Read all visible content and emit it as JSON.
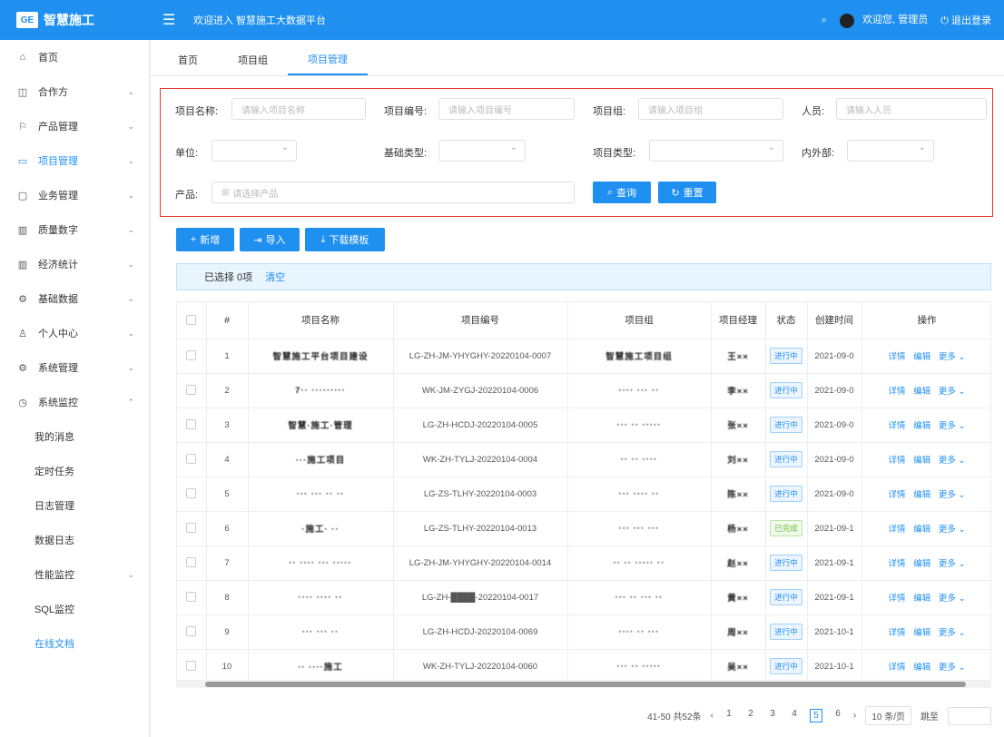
{
  "header": {
    "logo_badge": "GE",
    "app_name": "智慧施工",
    "welcome_text": "欢迎进入 智慧施工大数据平台",
    "user_greeting": "欢迎您,",
    "user_name": "管理员",
    "logout_label": "退出登录",
    "search_icon": "search-icon",
    "menu_icon": "menu-fold-icon"
  },
  "sidebar": {
    "items": [
      {
        "label": "首页",
        "icon": "⌂",
        "arrow": ""
      },
      {
        "label": "合作方",
        "icon": "◫",
        "arrow": "⌄"
      },
      {
        "label": "产品管理",
        "icon": "⚐",
        "arrow": "⌄"
      },
      {
        "label": "项目管理",
        "icon": "▭",
        "arrow": "⌄"
      },
      {
        "label": "业务管理",
        "icon": "▢",
        "arrow": "⌄"
      },
      {
        "label": "质量数字",
        "icon": "▥",
        "arrow": "⌄"
      },
      {
        "label": "经济统计",
        "icon": "▥",
        "arrow": "⌄"
      },
      {
        "label": "基础数据",
        "icon": "⚙",
        "arrow": "⌄"
      },
      {
        "label": "个人中心",
        "icon": "♙",
        "arrow": "⌄"
      },
      {
        "label": "系统管理",
        "icon": "⚙",
        "arrow": "⌄"
      },
      {
        "label": "系统监控",
        "icon": "◷",
        "arrow": "⌃"
      }
    ],
    "sub_items": [
      {
        "label": "我的消息",
        "arrow": ""
      },
      {
        "label": "定时任务",
        "arrow": ""
      },
      {
        "label": "日志管理",
        "arrow": ""
      },
      {
        "label": "数据日志",
        "arrow": ""
      },
      {
        "label": "性能监控",
        "arrow": "⌄"
      },
      {
        "label": "SQL监控",
        "arrow": ""
      },
      {
        "label": "在线文档",
        "arrow": ""
      }
    ]
  },
  "tabs": [
    "首页",
    "项目组",
    "项目管理"
  ],
  "search": {
    "project_name_label": "项目名称:",
    "project_name_ph": "请输入项目名称",
    "project_no_label": "项目编号:",
    "project_no_ph": "请输入项目编号",
    "project_group_label": "项目组:",
    "project_group_ph": "请输入项目组",
    "person_label": "人员:",
    "person_ph": "请输入人员",
    "unit_label": "单位:",
    "base_type_label": "基础类型:",
    "project_type_label": "项目类型:",
    "inner_outer_label": "内外部:",
    "product_label": "产品:",
    "product_ph": "请选择产品",
    "query_label": "查询",
    "reset_label": "重置"
  },
  "actions": {
    "add_label": "新增",
    "import_label": "导入",
    "download_label": "下载模板"
  },
  "selection": {
    "selected_text": "已选择 0项",
    "clear_label": "清空"
  },
  "table": {
    "headers": [
      "",
      "#",
      "项目名称",
      "项目编号",
      "项目组",
      "项目经理",
      "状态",
      "创建时间",
      "操作"
    ],
    "rows": [
      {
        "idx": "1",
        "name": "智慧施工平台项目建设",
        "code": "LG-ZH-JM-YHYGHY-20220104-0007",
        "group": "智慧施工项目组",
        "manager": "王××",
        "status": "进行中",
        "time": "2021-09-0",
        "done": false
      },
      {
        "idx": "2",
        "name": "7·· ·········",
        "code": "WK-JM-ZYGJ-20220104-0006",
        "group": "···· ··· ··",
        "manager": "李××",
        "status": "进行中",
        "time": "2021-09-0",
        "done": false
      },
      {
        "idx": "3",
        "name": "智慧·施工·管理",
        "code": "LG-ZH-HCDJ-20220104-0005",
        "group": "··· ·· ·····",
        "manager": "张××",
        "status": "进行中",
        "time": "2021-09-0",
        "done": false
      },
      {
        "idx": "4",
        "name": "···施工项目",
        "code": "WK-ZH-TYLJ-20220104-0004",
        "group": "·· ·· ····",
        "manager": "刘××",
        "status": "进行中",
        "time": "2021-09-0",
        "done": false
      },
      {
        "idx": "5",
        "name": "··· ··· ·· ··",
        "code": "LG-ZS-TLHY-20220104-0003",
        "group": "··· ···· ··",
        "manager": "陈××",
        "status": "进行中",
        "time": "2021-09-0",
        "done": false
      },
      {
        "idx": "6",
        "name": "·施工· ··",
        "code": "LG-ZS-TLHY-20220104-0013",
        "group": "··· ··· ···",
        "manager": "杨××",
        "status": "已完成",
        "time": "2021-09-1",
        "done": true
      },
      {
        "idx": "7",
        "name": "·· ···· ··· ·····",
        "code": "LG-ZH-JM-YHYGHY-20220104-0014",
        "group": "·· ·· ····· ··",
        "manager": "赵××",
        "status": "进行中",
        "time": "2021-09-1",
        "done": false
      },
      {
        "idx": "8",
        "name": "···· ···· ··",
        "code": "LG-ZH-████-20220104-0017",
        "group": "··· ·· ··· ··",
        "manager": "黄××",
        "status": "进行中",
        "time": "2021-09-1",
        "done": false
      },
      {
        "idx": "9",
        "name": "··· ··· ··",
        "code": "LG-ZH-HCDJ-20220104-0069",
        "group": "···· ·· ···",
        "manager": "周××",
        "status": "进行中",
        "time": "2021-10-1",
        "done": false
      },
      {
        "idx": "10",
        "name": "·· ····施工",
        "code": "WK-ZH-TYLJ-20220104-0060",
        "group": "··· ·· ·····",
        "manager": "吴××",
        "status": "进行中",
        "time": "2021-10-1",
        "done": false
      }
    ],
    "op_detail": "详情",
    "op_edit": "编辑",
    "op_more": "更多"
  },
  "pagination": {
    "summary": "41-50 共52条",
    "pages": [
      "1",
      "2",
      "3",
      "4",
      "5",
      "6"
    ],
    "active_page": "5",
    "page_size": "10 条/页",
    "goto_label": "跳至"
  }
}
